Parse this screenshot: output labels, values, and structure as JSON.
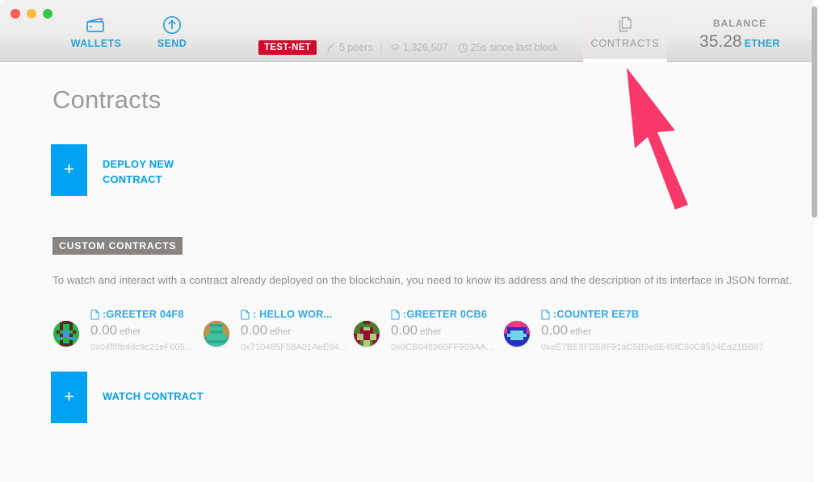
{
  "window": {
    "traffic_lights": [
      "close",
      "minimize",
      "maximize"
    ]
  },
  "header": {
    "nav": [
      {
        "label": "WALLETS",
        "icon": "wallet-icon",
        "active": false
      },
      {
        "label": "SEND",
        "icon": "send-up-arrow-icon",
        "active": false
      }
    ],
    "tab": {
      "label": "CONTRACTS",
      "icon": "contracts-documents-icon",
      "active": true
    },
    "status": {
      "network_badge": "TEST-NET",
      "peers": "5 peers",
      "block_number": "1,326,507",
      "last_block": "25s since last block",
      "separator": "|"
    },
    "balance": {
      "caption": "BALANCE",
      "amount": "35.28",
      "unit": "ETHER"
    }
  },
  "main": {
    "page_title": "Contracts",
    "deploy_button": {
      "plus": "+",
      "label_line1": "DEPLOY NEW",
      "label_line2": "CONTRACT"
    },
    "section": {
      "header": "CUSTOM CONTRACTS",
      "description": "To watch and interact with a contract already deployed on the blockchain, you need to know its address and the description of its interface in JSON format."
    },
    "watch_button": {
      "plus": "+",
      "label": "WATCH CONTRACT"
    },
    "contracts": [
      {
        "name": ":GREETER 04F8",
        "balance": "0.00",
        "balance_unit": "ether",
        "address": "0x04f8fb4dc9c21eF605...",
        "icon": "document-icon",
        "avatar": "identicon-green-brown"
      },
      {
        "name": ": HELLO WOR...",
        "balance": "0.00",
        "balance_unit": "ether",
        "address": "0x710485F58A01AeE94...",
        "icon": "document-icon",
        "avatar": "identicon-teal-tan"
      },
      {
        "name": ":GREETER 0CB6",
        "balance": "0.00",
        "balance_unit": "ether",
        "address": "0x0CB648960FF989AA...",
        "icon": "document-icon",
        "avatar": "identicon-crimson-olive"
      },
      {
        "name": ":COUNTER EE7B",
        "balance": "0.00",
        "balance_unit": "ether",
        "address": "0xeE7BE8FD58F91aC5B9e8E45fC80C8524Ea21BB67",
        "icon": "document-icon",
        "avatar": "identicon-blue-pink"
      }
    ]
  },
  "annotation": {
    "arrow": {
      "color": "#f9386a",
      "points_to": "contracts-tab"
    }
  },
  "colors": {
    "accent_blue": "#00a2f1",
    "nav_blue": "#2e9fd6",
    "testnet_red": "#cf0a2c",
    "section_gray": "#888481",
    "arrow_pink": "#f9386a"
  }
}
